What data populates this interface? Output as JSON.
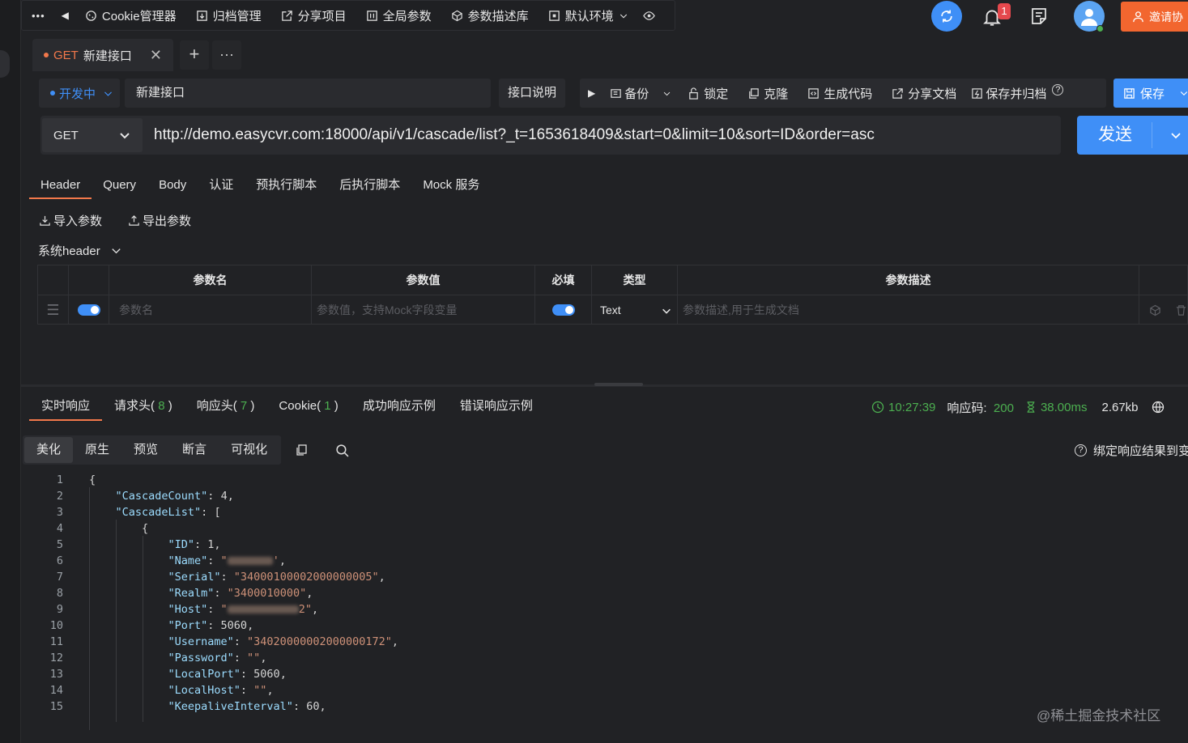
{
  "toolbar": {
    "more": "•••",
    "items": [
      {
        "icon": "cookie-icon",
        "label": "Cookie管理器"
      },
      {
        "icon": "archive-icon",
        "label": "归档管理"
      },
      {
        "icon": "share-icon",
        "label": "分享项目"
      },
      {
        "icon": "global-params-icon",
        "label": "全局参数"
      },
      {
        "icon": "cube-icon",
        "label": "参数描述库"
      },
      {
        "icon": "env-icon",
        "label": "默认环境"
      }
    ],
    "notification_count": "1",
    "invite_label": "邀请协"
  },
  "tabs": {
    "active": {
      "method": "GET",
      "name": "新建接口"
    },
    "add": "+",
    "more": "···"
  },
  "api": {
    "status": "开发中",
    "name": "新建接口",
    "doc_label": "接口说明",
    "actions": [
      "备份",
      "锁定",
      "克隆",
      "生成代码",
      "分享文档",
      "保存并归档"
    ],
    "save": "保存"
  },
  "request": {
    "method": "GET",
    "url": "http://demo.easycvr.com:18000/api/v1/cascade/list?_t=1653618409&start=0&limit=10&sort=ID&order=asc",
    "send": "发送"
  },
  "param_tabs": [
    "Header",
    "Query",
    "Body",
    "认证",
    "预执行脚本",
    "后执行脚本",
    "Mock 服务"
  ],
  "param_tools": {
    "import": "导入参数",
    "export": "导出参数",
    "system_header": "系统header"
  },
  "param_table": {
    "columns": [
      "参数名",
      "参数值",
      "必填",
      "类型",
      "参数描述"
    ],
    "row": {
      "name_placeholder": "参数名",
      "value_placeholder": "参数值，支持Mock字段变量",
      "type": "Text",
      "desc_placeholder": "参数描述,用于生成文档"
    }
  },
  "response": {
    "tabs": [
      {
        "label": "实时响应",
        "count": ""
      },
      {
        "label": "请求头",
        "count": "8"
      },
      {
        "label": "响应头",
        "count": "7"
      },
      {
        "label": "Cookie",
        "count": "1"
      },
      {
        "label": "成功响应示例",
        "count": ""
      },
      {
        "label": "错误响应示例",
        "count": ""
      }
    ],
    "time": "10:27:39",
    "code_label": "响应码:",
    "code": "200",
    "duration": "38.00ms",
    "size": "2.67kb",
    "view_modes": [
      "美化",
      "原生",
      "预览",
      "断言",
      "可视化"
    ],
    "bind_label": "绑定响应结果到变"
  },
  "code_lines": [
    {
      "n": "1",
      "t": "{"
    },
    {
      "n": "2",
      "k": "\"CascadeCount\"",
      "v": "4",
      "type": "num",
      "indent": 1
    },
    {
      "n": "3",
      "k": "\"CascadeList\"",
      "v": "[",
      "type": "punct",
      "indent": 1
    },
    {
      "n": "4",
      "t": "{",
      "indent": 2
    },
    {
      "n": "5",
      "k": "\"ID\"",
      "v": "1",
      "type": "num",
      "indent": 3
    },
    {
      "n": "6",
      "k": "\"Name\"",
      "v": "\"",
      "type": "blur",
      "indent": 3
    },
    {
      "n": "7",
      "k": "\"Serial\"",
      "v": "\"34000100002000000005\"",
      "type": "str",
      "indent": 3
    },
    {
      "n": "8",
      "k": "\"Realm\"",
      "v": "\"3400010000\"",
      "type": "str",
      "indent": 3
    },
    {
      "n": "9",
      "k": "\"Host\"",
      "v": "\"",
      "type": "blurhost",
      "indent": 3
    },
    {
      "n": "10",
      "k": "\"Port\"",
      "v": "5060",
      "type": "num",
      "indent": 3
    },
    {
      "n": "11",
      "k": "\"Username\"",
      "v": "\"34020000002000000172\"",
      "type": "str",
      "indent": 3
    },
    {
      "n": "12",
      "k": "\"Password\"",
      "v": "\"\"",
      "type": "str",
      "indent": 3
    },
    {
      "n": "13",
      "k": "\"LocalPort\"",
      "v": "5060",
      "type": "num",
      "indent": 3
    },
    {
      "n": "14",
      "k": "\"LocalHost\"",
      "v": "\"\"",
      "type": "str",
      "indent": 3
    },
    {
      "n": "15",
      "k": "\"KeepaliveInterval\"",
      "v": "60",
      "type": "num",
      "indent": 3
    }
  ],
  "watermark": "@稀土掘金技术社区"
}
